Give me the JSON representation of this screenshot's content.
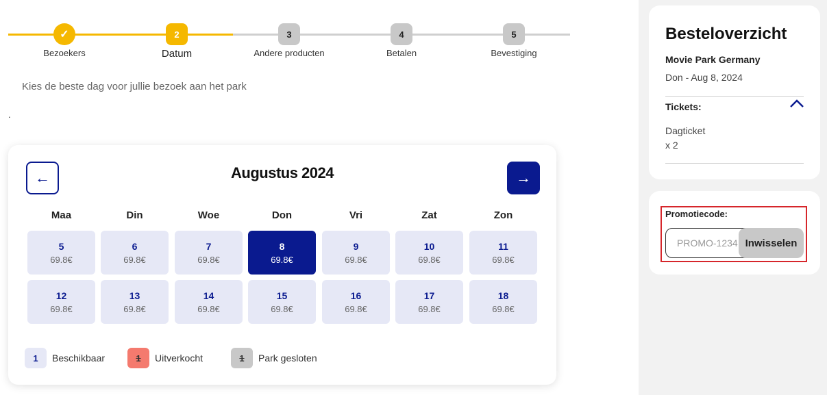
{
  "stepper": {
    "steps": [
      {
        "label": "Bezoekers",
        "marker": "✓",
        "state": "done"
      },
      {
        "label": "Datum",
        "marker": "2",
        "state": "active"
      },
      {
        "label": "Andere producten",
        "marker": "3",
        "state": "pending"
      },
      {
        "label": "Betalen",
        "marker": "4",
        "state": "pending"
      },
      {
        "label": "Bevestiging",
        "marker": "5",
        "state": "pending"
      }
    ]
  },
  "intro_text": "Kies de beste dag voor jullie bezoek aan het park",
  "stray_dot": ".",
  "calendar": {
    "month_title": "Augustus 2024",
    "prev_icon": "←",
    "next_icon": "→",
    "weekdays": [
      "Maa",
      "Din",
      "Woe",
      "Don",
      "Vri",
      "Zat",
      "Zon"
    ],
    "days": [
      {
        "num": "5",
        "price": "69.8€"
      },
      {
        "num": "6",
        "price": "69.8€"
      },
      {
        "num": "7",
        "price": "69.8€"
      },
      {
        "num": "8",
        "price": "69.8€",
        "selected": true
      },
      {
        "num": "9",
        "price": "69.8€"
      },
      {
        "num": "10",
        "price": "69.8€"
      },
      {
        "num": "11",
        "price": "69.8€"
      },
      {
        "num": "12",
        "price": "69.8€"
      },
      {
        "num": "13",
        "price": "69.8€"
      },
      {
        "num": "14",
        "price": "69.8€"
      },
      {
        "num": "15",
        "price": "69.8€"
      },
      {
        "num": "16",
        "price": "69.8€"
      },
      {
        "num": "17",
        "price": "69.8€"
      },
      {
        "num": "18",
        "price": "69.8€"
      }
    ],
    "legend": [
      {
        "marker": "1",
        "label": "Beschikbaar"
      },
      {
        "marker": "1",
        "label": "Uitverkocht"
      },
      {
        "marker": "1",
        "label": "Park gesloten"
      }
    ]
  },
  "summary": {
    "title": "Besteloverzicht",
    "park": "Movie Park Germany",
    "date": "Don - Aug 8, 2024",
    "tickets_label": "Tickets:",
    "ticket_name": "Dagticket",
    "ticket_qty": "x 2"
  },
  "promo": {
    "label": "Promotiecode:",
    "placeholder": "PROMO-1234",
    "button": "Inwisselen"
  },
  "colors": {
    "accent_yellow": "#f5b800",
    "brand_blue": "#0a1a8f",
    "available": "#e6e8f6",
    "sold_out": "#f47a6e",
    "closed": "#c8c8c8",
    "highlight_frame": "#d6262b"
  }
}
